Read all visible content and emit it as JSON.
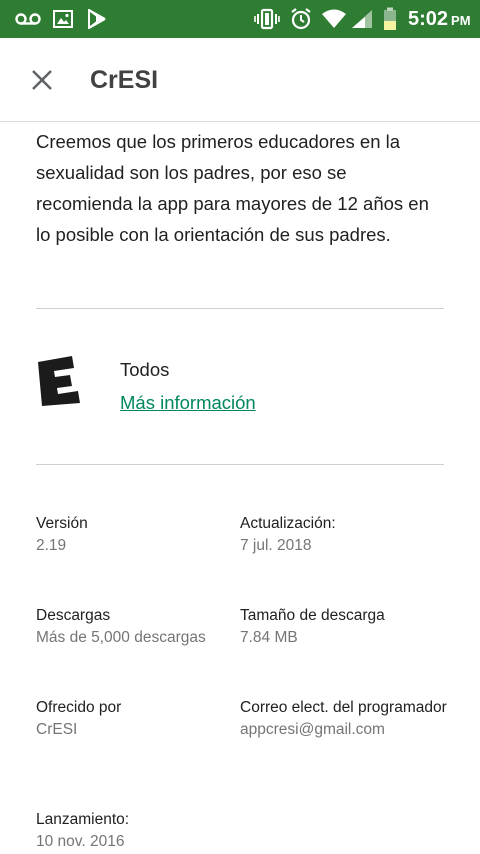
{
  "status_bar": {
    "time": "5:02",
    "ampm": "PM",
    "bg_color": "#2e7d32",
    "icons": [
      "voicemail-icon",
      "image-icon",
      "play-store-icon",
      "vibrate-icon",
      "alarm-icon",
      "wifi-icon",
      "signal-icon",
      "battery-icon"
    ]
  },
  "appbar": {
    "title": "CrESI",
    "close_icon": "close-icon"
  },
  "description": "Creemos que los primeros educadores en la sexualidad son los padres, por eso se recomienda la app para mayores de 12 años en lo posible con la orientación de sus padres.",
  "content_rating": {
    "icon": "esrb-everyone-icon",
    "label": "Todos",
    "link": "Más información",
    "link_color": "#01875f"
  },
  "info": {
    "version_label": "Versión",
    "version_value": "2.19",
    "update_label": "Actualización:",
    "update_value": "7 jul. 2018",
    "downloads_label": "Descargas",
    "downloads_value": "Más de 5,000 descargas",
    "size_label": "Tamaño de descarga",
    "size_value": "7.84 MB",
    "offered_label": "Ofrecido por",
    "offered_value": "CrESI",
    "email_label": "Correo elect. del programador",
    "email_value": "appcresi@gmail.com",
    "release_label": "Lanzamiento:",
    "release_value": "10 nov. 2016"
  }
}
